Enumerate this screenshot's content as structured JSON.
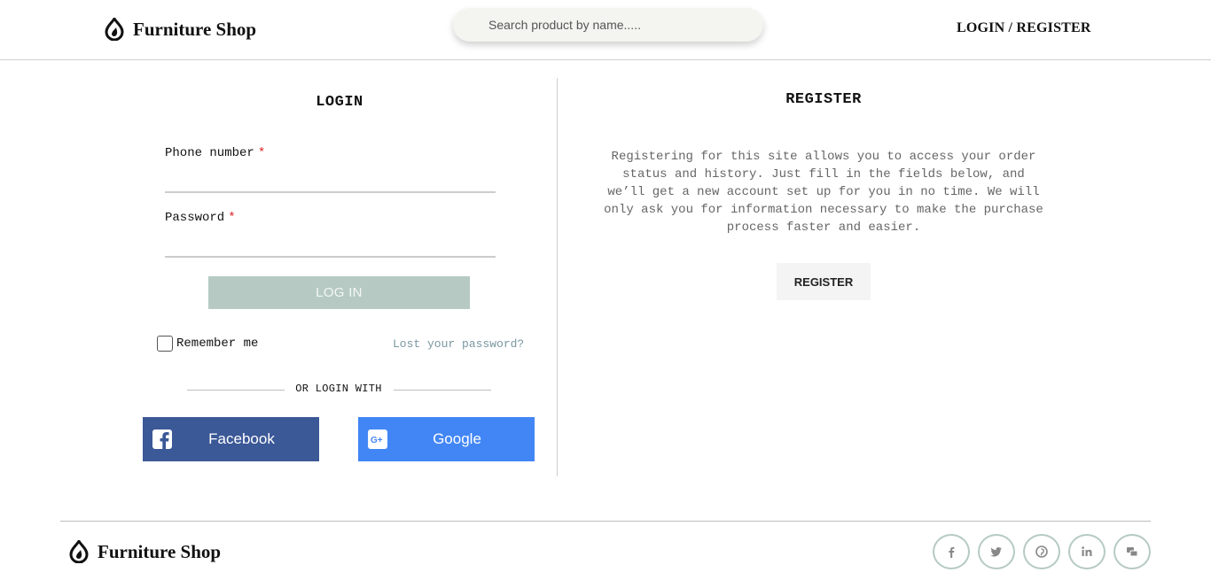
{
  "header": {
    "brand_name": "Furniture Shop",
    "search_placeholder": "Search product by name.....",
    "auth_link": "LOGIN / REGISTER"
  },
  "login": {
    "title": "LOGIN",
    "phone_label": "Phone number",
    "password_label": "Password",
    "required_mark": "*",
    "login_button": "LOG IN",
    "remember_label": "Remember me",
    "remember_checked": false,
    "lost_password": "Lost your password?",
    "or_login_with": "OR LOGIN WITH",
    "facebook_label": "Facebook",
    "google_label": "Google"
  },
  "register": {
    "title": "REGISTER",
    "description": "Registering for this site allows you to access your order status and history. Just fill in the fields below, and we’ll get a new account set up for you in no time. We will only ask you for information necessary to make the purchase process faster and easier.",
    "button": "REGISTER"
  },
  "footer": {
    "brand_name": "Furniture Shop",
    "social_icons": [
      "facebook-icon",
      "twitter-icon",
      "pinterest-icon",
      "linkedin-icon",
      "chat-icon"
    ]
  },
  "colors": {
    "facebook": "#3b5897",
    "google": "#4286f5",
    "login_button": "#b6cac3",
    "accent_link": "#7a97a1",
    "required": "#dd2222"
  }
}
